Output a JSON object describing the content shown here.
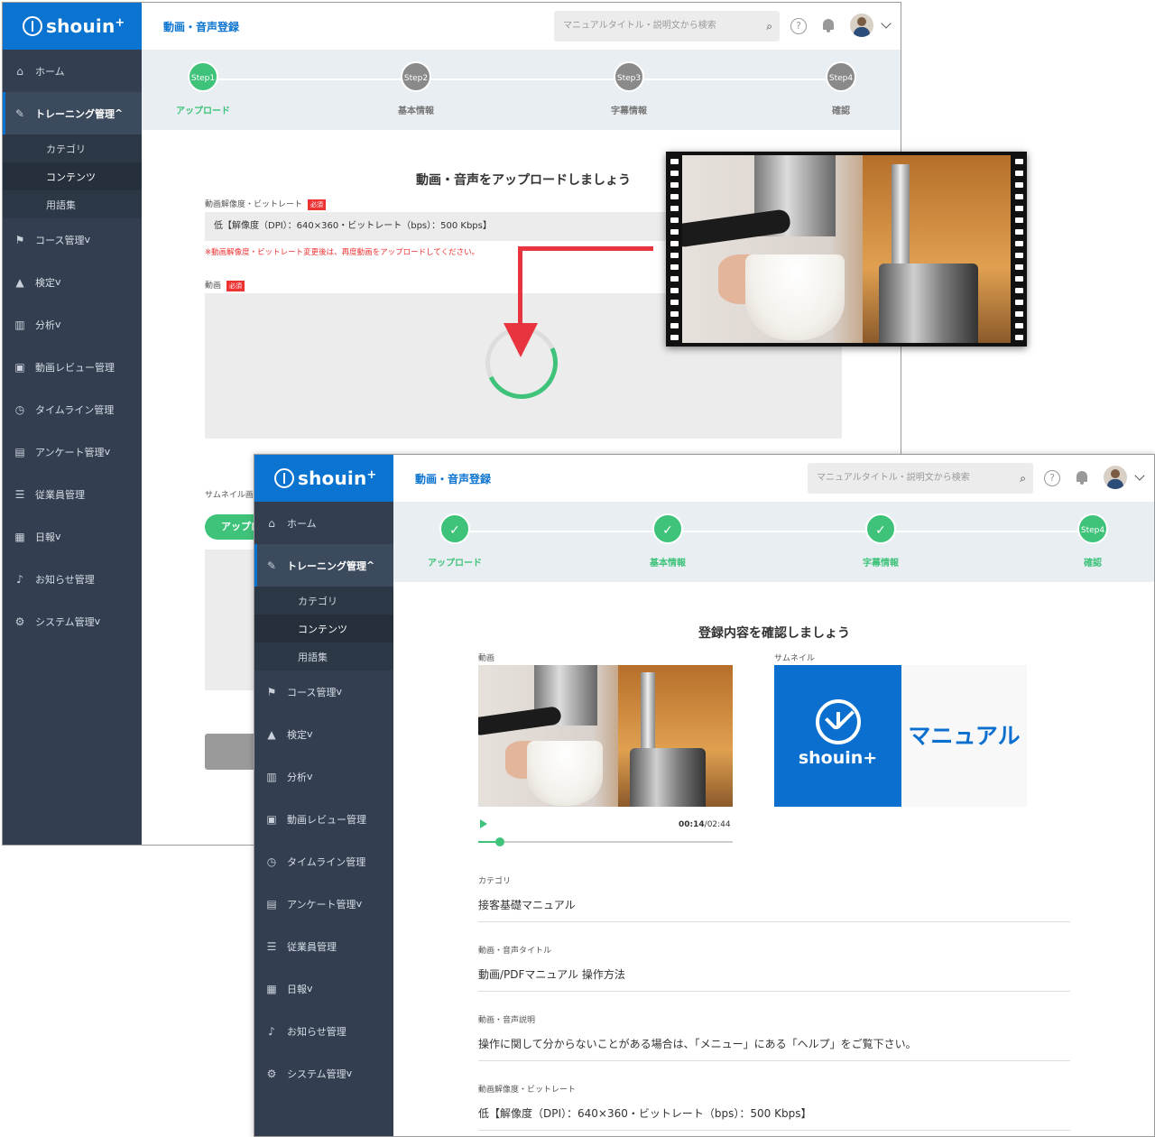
{
  "brand": {
    "name": "shouin",
    "plus": "+"
  },
  "topbar": {
    "page_title": "動画・音声登録",
    "search_placeholder": "マニュアルタイトル・説明文から検索",
    "help": "?"
  },
  "sidebar": {
    "items": [
      {
        "label": "ホーム",
        "icon": "home-icon"
      },
      {
        "label": "トレーニング管理",
        "caret": "^",
        "icon": "edit-icon"
      },
      {
        "label": "コース管理",
        "caret": "v",
        "icon": "flag-icon"
      },
      {
        "label": "検定",
        "caret": "v",
        "icon": "graduation-cap-icon"
      },
      {
        "label": "分析",
        "caret": "v",
        "icon": "bar-chart-icon"
      },
      {
        "label": "動画レビュー管理",
        "icon": "video-file-icon"
      },
      {
        "label": "タイムライン管理",
        "icon": "clock-icon"
      },
      {
        "label": "アンケート管理",
        "caret": "v",
        "icon": "survey-icon"
      },
      {
        "label": "従業員管理",
        "icon": "user-list-icon"
      },
      {
        "label": "日報",
        "caret": "v",
        "icon": "report-icon"
      },
      {
        "label": "お知らせ管理",
        "icon": "bell-icon"
      },
      {
        "label": "システム管理",
        "caret": "v",
        "icon": "gear-icon"
      }
    ],
    "subitems": [
      "カテゴリ",
      "コンテンツ",
      "用語集"
    ]
  },
  "steps": [
    {
      "num": "Step1",
      "label": "アップロード"
    },
    {
      "num": "Step2",
      "label": "基本情報"
    },
    {
      "num": "Step3",
      "label": "字幕情報"
    },
    {
      "num": "Step4",
      "label": "確認"
    }
  ],
  "step_done_mark": "✓",
  "upload_screen": {
    "heading": "動画・音声をアップロードしましょう",
    "resolution_label": "動画解像度・ビットレート",
    "required": "必須",
    "resolution_value": "低【解像度（DPI）：640×360・ビットレート（bps）：500 Kbps】",
    "warning": "※動画解像度・ビットレート変更後は、再度動画をアップロードしてください。",
    "video_label": "動画",
    "thumbnail_label": "サムネイル画",
    "upload_button": "アップロ",
    "upload_progress": 0.6
  },
  "confirm_screen": {
    "heading": "登録内容を確認しましょう",
    "video_label": "動画",
    "thumbnail_label": "サムネイル",
    "thumbnail_brand": "shouin+",
    "thumbnail_text": "マニュアル",
    "time_current": "00:14",
    "time_total": "/02:44",
    "playback_fraction": 0.085,
    "fields": [
      {
        "k": "カテゴリ",
        "v": "接客基礎マニュアル"
      },
      {
        "k": "動画・音声タイトル",
        "v": "動画/PDFマニュアル 操作方法"
      },
      {
        "k": "動画・音声説明",
        "v": "操作に関して分からないことがある場合は、「メニュー」にある「ヘルプ」をご覧下さい。"
      },
      {
        "k": "動画解像度・ビットレート",
        "v": "低【解像度（DPI）：640×360・ビットレート（bps）：500 Kbps】"
      }
    ]
  },
  "colors": {
    "brand_blue": "#0b73d0",
    "accent_green": "#3fc37a",
    "sidebar_bg": "#333f50",
    "arrow_red": "#e8343f"
  }
}
